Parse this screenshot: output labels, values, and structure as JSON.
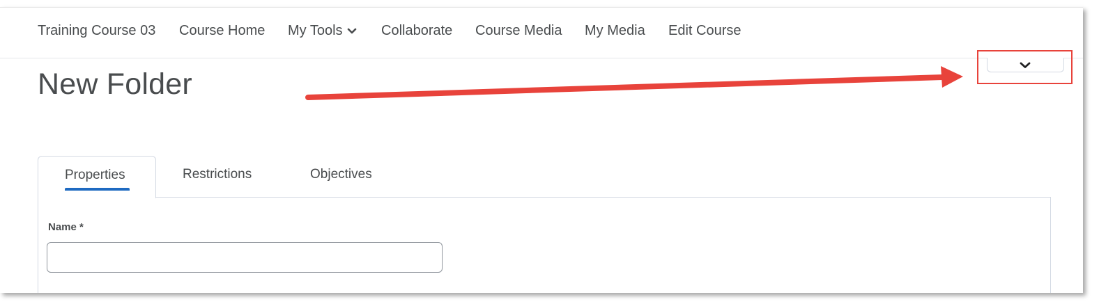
{
  "navbar": {
    "items": [
      {
        "label": "Training Course 03"
      },
      {
        "label": "Course Home"
      },
      {
        "label": "My Tools"
      },
      {
        "label": "Collaborate"
      },
      {
        "label": "Course Media"
      },
      {
        "label": "My Media"
      },
      {
        "label": "Edit Course"
      }
    ]
  },
  "page": {
    "title": "New Folder"
  },
  "tabs": [
    {
      "label": "Properties",
      "active": true
    },
    {
      "label": "Restrictions",
      "active": false
    },
    {
      "label": "Objectives",
      "active": false
    }
  ],
  "form": {
    "name_label": "Name *",
    "name_value": ""
  },
  "colors": {
    "annotation": "#e8433b",
    "tab_underline": "#1e6ac1",
    "text": "#494c4e"
  },
  "icons": {
    "my_tools_dropdown": "chevron-down-icon",
    "collapse_button": "chevron-down-icon"
  }
}
